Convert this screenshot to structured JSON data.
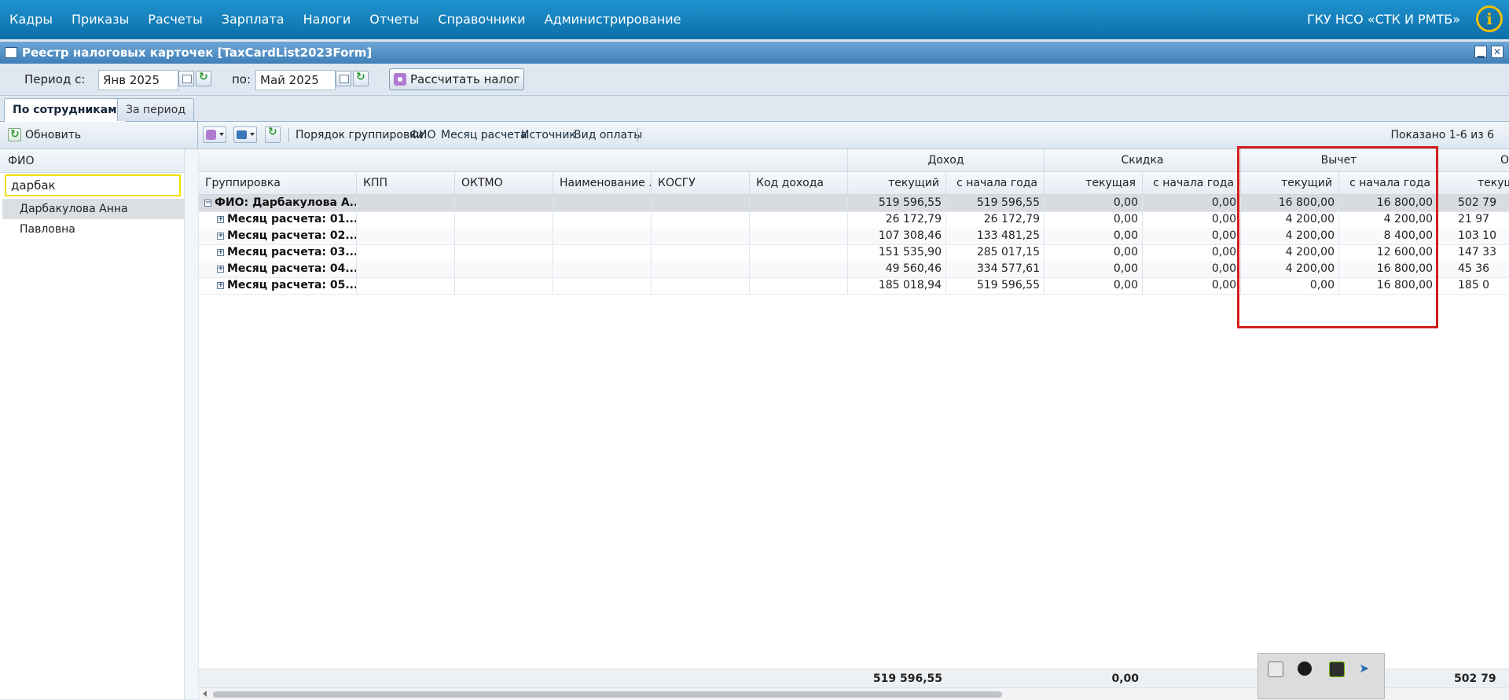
{
  "topnav": {
    "items": [
      "Кадры",
      "Приказы",
      "Расчеты",
      "Зарплата",
      "Налоги",
      "Отчеты",
      "Справочники",
      "Администрирование"
    ],
    "org": "ГКУ НСО «СТК И РМТБ»",
    "info_icon": "info-icon"
  },
  "window": {
    "title": "Реестр налоговых карточек [TaxCardList2023Form]",
    "minimize": "▁",
    "close": "✕"
  },
  "period": {
    "from_label": "Период с:",
    "from_value": "Янв 2025",
    "to_label": "по:",
    "to_value": "Май 2025",
    "calc_button": "Рассчитать налог"
  },
  "tabs": [
    "По сотрудникам",
    "За период"
  ],
  "left_panel": {
    "refresh": "Обновить",
    "header": "ФИО",
    "search_value": "дарбак",
    "items": [
      "Дарбакулова Анна Павловна"
    ]
  },
  "grid_toolbar": {
    "grouping_label": "Порядок группировки:",
    "grouping_items": [
      "ФИО",
      "Месяц расчета",
      "Источник",
      "Вид оплаты"
    ],
    "shown": "Показано 1-6 из 6"
  },
  "columns": {
    "group_headers": [
      "Доход",
      "Скидка",
      "Вычет",
      "Об"
    ],
    "subheaders": [
      "Группировка",
      "КПП",
      "ОКТМО",
      "Наименование ...",
      "КОСГУ",
      "Код дохода",
      "текущий",
      "с начала года",
      "текущая",
      "с начала года",
      "текущий",
      "с начала года",
      "текущ"
    ]
  },
  "rows": [
    {
      "label": "ФИО: Дарбакулова А...",
      "type": "group",
      "sign": "−",
      "v": [
        "519 596,55",
        "519 596,55",
        "0,00",
        "0,00",
        "16 800,00",
        "16 800,00",
        "502 79"
      ]
    },
    {
      "label": "Месяц расчета: 01....",
      "type": "sub",
      "sign": "+",
      "v": [
        "26 172,79",
        "26 172,79",
        "0,00",
        "0,00",
        "4 200,00",
        "4 200,00",
        "21 97"
      ]
    },
    {
      "label": "Месяц расчета: 02....",
      "type": "sub",
      "sign": "+",
      "v": [
        "107 308,46",
        "133 481,25",
        "0,00",
        "0,00",
        "4 200,00",
        "8 400,00",
        "103 10"
      ]
    },
    {
      "label": "Месяц расчета: 03....",
      "type": "sub",
      "sign": "+",
      "v": [
        "151 535,90",
        "285 017,15",
        "0,00",
        "0,00",
        "4 200,00",
        "12 600,00",
        "147 33"
      ]
    },
    {
      "label": "Месяц расчета: 04....",
      "type": "sub",
      "sign": "+",
      "v": [
        "49 560,46",
        "334 577,61",
        "0,00",
        "0,00",
        "4 200,00",
        "16 800,00",
        "45 36"
      ]
    },
    {
      "label": "Месяц расчета: 05....",
      "type": "sub",
      "sign": "+",
      "v": [
        "185 018,94",
        "519 596,55",
        "0,00",
        "0,00",
        "0,00",
        "16 800,00",
        "185 0"
      ]
    }
  ],
  "totals": [
    "519 596,55",
    "0,00",
    "502 79"
  ],
  "colors": {
    "topbar": "#1a8ac6",
    "highlight": "#d41e1e",
    "search_border": "#f0e000"
  }
}
